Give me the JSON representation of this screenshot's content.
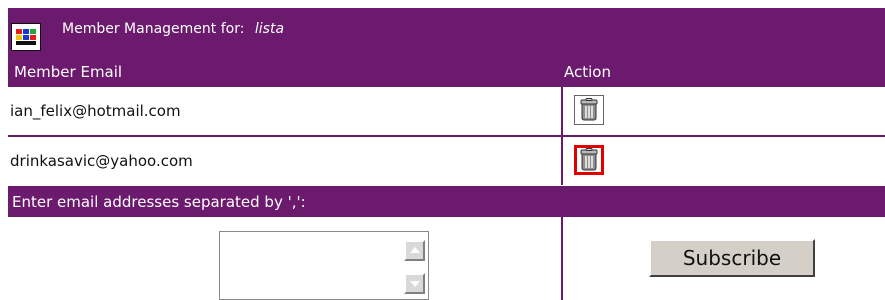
{
  "title": {
    "prefix": "Member Management for:",
    "list_name": "lista"
  },
  "table": {
    "headers": {
      "email": "Member Email",
      "action": "Action"
    },
    "members": [
      {
        "email": "ian_felix@hotmail.com",
        "action_icon": "trash-can-icon",
        "selected": false
      },
      {
        "email": "drinkasavic@yahoo.com",
        "action_icon": "trash-can-icon",
        "selected": true
      }
    ]
  },
  "subscribe": {
    "instruction": "Enter email addresses separated by ',':",
    "textarea_value": "",
    "button_label": "Subscribe"
  },
  "icons": {
    "title_icon": "window-app-icon",
    "delete_icon": "trash-can-icon",
    "scroll_up_icon": "triangle-up-icon",
    "scroll_down_icon": "triangle-down-icon"
  },
  "colors": {
    "header_purple": "#6b1a6e",
    "selection_red": "#e00000",
    "button_gray": "#d4d0c8"
  }
}
